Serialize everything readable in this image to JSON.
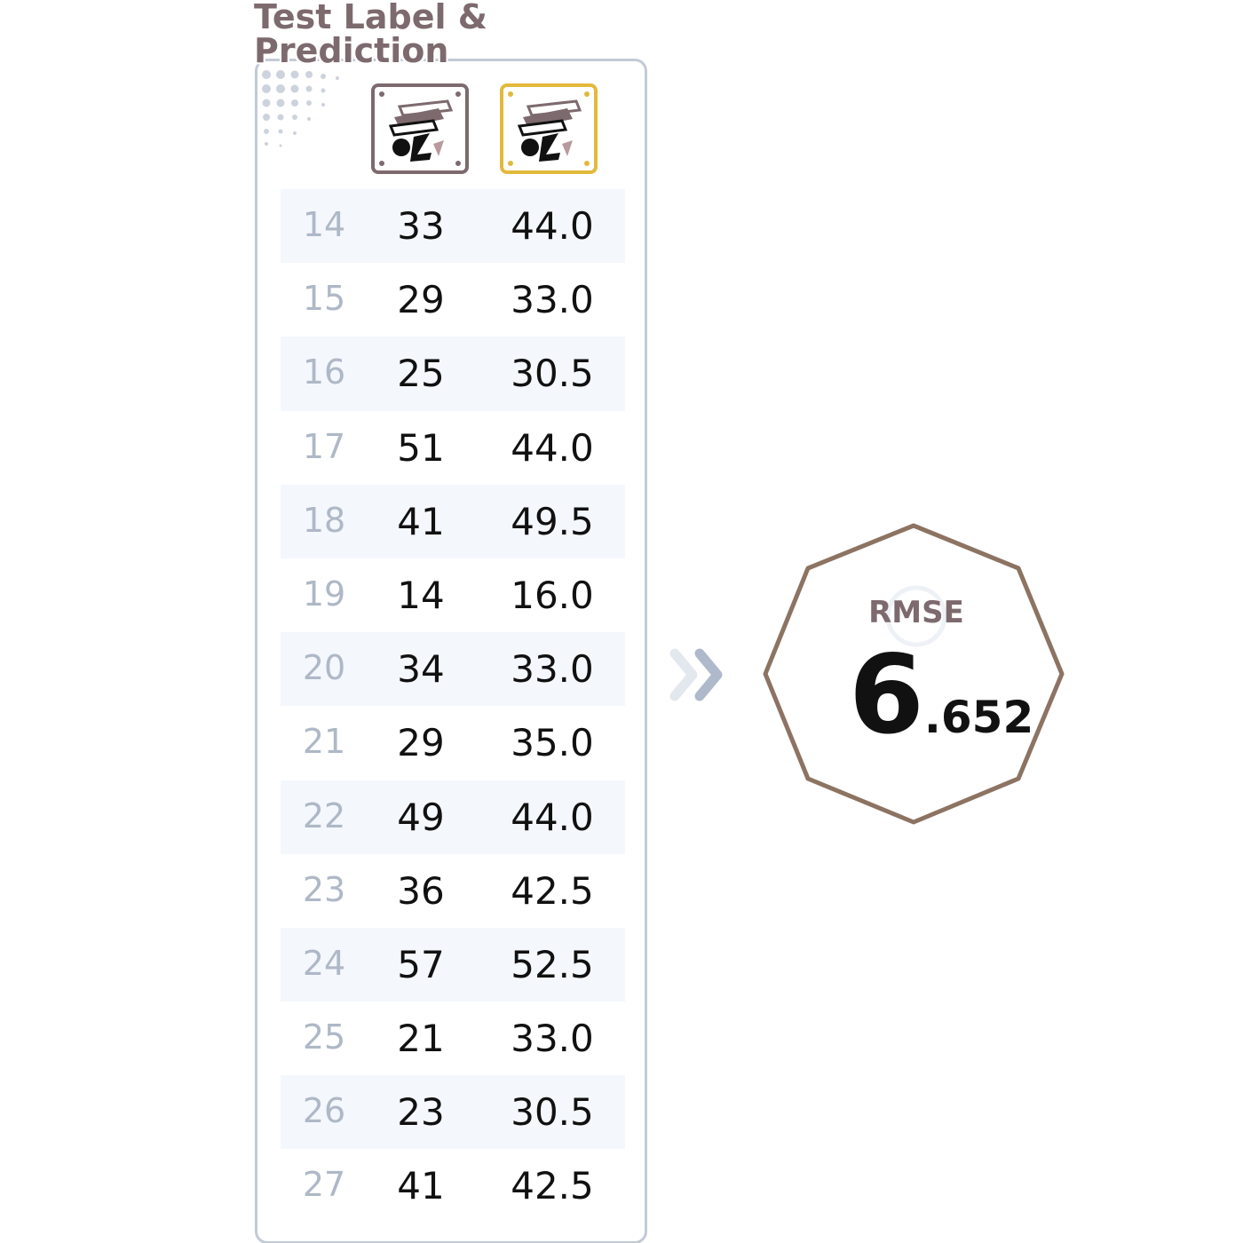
{
  "title": {
    "line1": "Test Label &",
    "line2": "Prediction"
  },
  "columns": [
    {
      "name": "label",
      "icon": "game-icon",
      "border_color": "#7d6a6e"
    },
    {
      "name": "prediction",
      "icon": "game-icon",
      "border_color": "#e2b93b"
    }
  ],
  "rows": [
    {
      "index": "14",
      "label": "33",
      "prediction": "44.0"
    },
    {
      "index": "15",
      "label": "29",
      "prediction": "33.0"
    },
    {
      "index": "16",
      "label": "25",
      "prediction": "30.5"
    },
    {
      "index": "17",
      "label": "51",
      "prediction": "44.0"
    },
    {
      "index": "18",
      "label": "41",
      "prediction": "49.5"
    },
    {
      "index": "19",
      "label": "14",
      "prediction": "16.0"
    },
    {
      "index": "20",
      "label": "34",
      "prediction": "33.0"
    },
    {
      "index": "21",
      "label": "29",
      "prediction": "35.0"
    },
    {
      "index": "22",
      "label": "49",
      "prediction": "44.0"
    },
    {
      "index": "23",
      "label": "36",
      "prediction": "42.5"
    },
    {
      "index": "24",
      "label": "57",
      "prediction": "52.5"
    },
    {
      "index": "25",
      "label": "21",
      "prediction": "33.0"
    },
    {
      "index": "26",
      "label": "23",
      "prediction": "30.5"
    },
    {
      "index": "27",
      "label": "41",
      "prediction": "42.5"
    }
  ],
  "arrow_icon": "double-chevron-right-icon",
  "metric": {
    "label": "RMSE",
    "value_int": "6",
    "value_frac": ".652",
    "badge_shape": "octagon",
    "badge_color": "#8c7362"
  },
  "colors": {
    "label_accent": "#7d6a6e",
    "prediction_accent": "#e2b93b",
    "row_stripe": "#f4f7fc",
    "panel_border": "#c2cad5",
    "index_text": "#aeb8c6"
  }
}
